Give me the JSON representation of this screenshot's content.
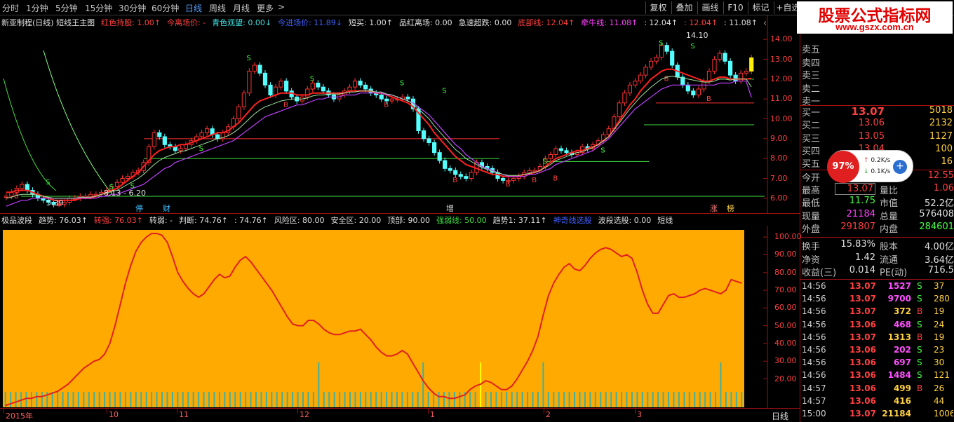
{
  "toolbar": {
    "periods": [
      "分时",
      "1分钟",
      "5分钟",
      "15分钟",
      "30分钟",
      "60分钟",
      "日线",
      "周线",
      "月线",
      "更多"
    ],
    "active_period": "日线",
    "more_arrow": ">",
    "buttons": [
      "复权",
      "叠加",
      "画线",
      "F10",
      "标记",
      "+自选"
    ]
  },
  "watermark": {
    "title": "股票公式指标网",
    "url": "www.gszx.com.cn"
  },
  "main_legend": {
    "items": [
      {
        "text": "新亚制程(日线) 短线王主图",
        "color": "#e0e0e0"
      },
      {
        "text": "红色持股: 1.00↑",
        "color": "#ff4040"
      },
      {
        "text": "今离场价: -",
        "color": "#ff4040"
      },
      {
        "text": "青色观望: 0.00↓",
        "color": "#40e0e0"
      },
      {
        "text": "今进场价: 11.89↓",
        "color": "#4060ff"
      },
      {
        "text": "短买: 1.00↑",
        "color": "#e0e0e0"
      },
      {
        "text": "品红离场: 0.00",
        "color": "#e0e0e0"
      },
      {
        "text": "急速超跌: 0.00",
        "color": "#e0e0e0"
      },
      {
        "text": "底部线: 12.04↑",
        "color": "#ff4040"
      },
      {
        "text": "牵牛线: 11.08↑",
        "color": "#ff40ff"
      },
      {
        "text": ": 12.04↑",
        "color": "#e0e0e0"
      },
      {
        "text": ": 12.04↑",
        "color": "#ff4040"
      },
      {
        "text": ": 11.08↑",
        "color": "#e0e0e0"
      },
      {
        "text": "◇ ☐",
        "color": "#e0e0e0"
      }
    ]
  },
  "price_axis": {
    "ticks": [
      "14.00",
      "13.00",
      "12.00",
      "11.00",
      "10.00",
      "9.00",
      "8.00",
      "7.00",
      "6.00"
    ],
    "min": 5.5,
    "max": 14.5
  },
  "price_annotations": {
    "high": "14.10",
    "low": "5.39",
    "range": "8.13 - 6.20"
  },
  "event_markers": [
    {
      "text": "停",
      "color": "#40c0ff"
    },
    {
      "text": "财",
      "color": "#40c0ff"
    },
    {
      "text": "增",
      "color": "#e0e0e0"
    },
    {
      "text": "涨",
      "color": "#ff8080"
    },
    {
      "text": "榜",
      "color": "#ffd040"
    }
  ],
  "sub_legend": {
    "items": [
      {
        "text": "极品波段",
        "color": "#e0e0e0"
      },
      {
        "text": "趋势: 76.03↑",
        "color": "#e0e0e0"
      },
      {
        "text": "转强: 76.03↑",
        "color": "#ff4040"
      },
      {
        "text": "转弱: -",
        "color": "#e0e0e0"
      },
      {
        "text": "判断: 74.76↑",
        "color": "#e0e0e0"
      },
      {
        "text": ": 74.76↑",
        "color": "#e0e0e0"
      },
      {
        "text": "风险区: 80.00",
        "color": "#e0e0e0"
      },
      {
        "text": "安全区: 20.00",
        "color": "#e0e0e0"
      },
      {
        "text": "顶部: 90.00",
        "color": "#e0e0e0"
      },
      {
        "text": "强弱线: 50.00",
        "color": "#40e040"
      },
      {
        "text": "趋势1: 37.11↑",
        "color": "#e0e0e0"
      },
      {
        "text": "神奇线选股",
        "color": "#4060ff"
      },
      {
        "text": "波段选股: 0.00",
        "color": "#e0e0e0"
      },
      {
        "text": "短线",
        "color": "#e0e0e0"
      }
    ]
  },
  "osc_axis": {
    "ticks": [
      "100.00",
      "90.00",
      "80.00",
      "70.00",
      "60.00",
      "50.00",
      "40.00",
      "30.00",
      "20.00"
    ],
    "min": 4,
    "max": 104
  },
  "date_axis": {
    "labels": [
      "2015年",
      "10",
      "11",
      "12",
      "1",
      "2",
      "3"
    ],
    "right_label": "日线"
  },
  "chart_data": [
    {
      "type": "candlestick",
      "title": "新亚制程(日线) 短线王主图",
      "xlabel": "",
      "ylabel": "",
      "ylim": [
        5.5,
        14.5
      ],
      "x_labels": [
        "2015年",
        "10",
        "11",
        "12",
        "1",
        "2",
        "3"
      ],
      "close": [
        6.1,
        6.3,
        6.5,
        6.7,
        6.4,
        6.2,
        6.0,
        5.9,
        5.8,
        5.7,
        5.7,
        5.8,
        6.0,
        6.0,
        6.1,
        6.1,
        6.2,
        6.2,
        6.3,
        6.4,
        6.6,
        6.8,
        7.0,
        7.1,
        7.3,
        7.4,
        7.8,
        8.6,
        9.3,
        9.1,
        8.7,
        8.6,
        8.4,
        8.5,
        8.7,
        8.9,
        9.1,
        9.3,
        9.5,
        9.2,
        9.0,
        9.3,
        9.6,
        10.0,
        10.6,
        11.3,
        12.4,
        12.7,
        12.3,
        11.7,
        11.2,
        11.6,
        11.9,
        11.4,
        11.1,
        10.9,
        11.1,
        11.5,
        11.8,
        11.6,
        11.4,
        11.2,
        11.0,
        11.2,
        11.4,
        11.6,
        11.9,
        11.7,
        11.5,
        11.3,
        11.2,
        11.0,
        10.9,
        11.0,
        11.0,
        11.1,
        11.0,
        10.5,
        9.4,
        9.0,
        8.8,
        8.3,
        7.9,
        7.5,
        7.4,
        7.2,
        7.1,
        7.0,
        7.3,
        7.8,
        7.6,
        7.5,
        7.3,
        7.0,
        6.9,
        6.9,
        7.0,
        7.1,
        7.3,
        7.4,
        7.4,
        7.6,
        8.0,
        8.2,
        8.5,
        8.4,
        8.3,
        8.2,
        8.3,
        8.6,
        8.5,
        8.7,
        8.9,
        9.2,
        9.5,
        10.1,
        10.8,
        11.3,
        11.7,
        11.9,
        12.2,
        12.6,
        12.9,
        13.1,
        13.7,
        13.4,
        12.7,
        12.1,
        11.7,
        11.4,
        11.2,
        11.5,
        11.9,
        12.4,
        13.0,
        13.3,
        12.9,
        12.2,
        11.9,
        12.3,
        12.4,
        13.07
      ],
      "ma_short": [
        6.3,
        6.3,
        6.4,
        6.4,
        6.4,
        6.3,
        6.2,
        6.1,
        6.0,
        5.9,
        5.9,
        5.9,
        5.9,
        5.9,
        6.0,
        6.0,
        6.0,
        6.1,
        6.2,
        6.3,
        6.4,
        6.5,
        6.7,
        6.9,
        7.1,
        7.3,
        7.6,
        7.9,
        8.2,
        8.4,
        8.5,
        8.6,
        8.6,
        8.7,
        8.7,
        8.8,
        8.9,
        9.0,
        9.1,
        9.2,
        9.3,
        9.3,
        9.4,
        9.6,
        9.8,
        10.1,
        10.4,
        10.7,
        10.9,
        11.0,
        11.1,
        11.2,
        11.3,
        11.3,
        11.3,
        11.2,
        11.2,
        11.2,
        11.3,
        11.3,
        11.3,
        11.3,
        11.3,
        11.3,
        11.3,
        11.4,
        11.4,
        11.4,
        11.4,
        11.4,
        11.3,
        11.3,
        11.2,
        11.1,
        11.0,
        10.9,
        10.8,
        10.6,
        10.3,
        10.0,
        9.7,
        9.3,
        9.0,
        8.7,
        8.4,
        8.1,
        7.9,
        7.7,
        7.6,
        7.5,
        7.4,
        7.3,
        7.2,
        7.2,
        7.1,
        7.1,
        7.1,
        7.1,
        7.2,
        7.2,
        7.3,
        7.4,
        7.6,
        7.8,
        8.0,
        8.1,
        8.2,
        8.3,
        8.4,
        8.4,
        8.5,
        8.6,
        8.7,
        8.9,
        9.1,
        9.5,
        9.9,
        10.3,
        10.7,
        11.0,
        11.4,
        11.7,
        12.0,
        12.2,
        12.4,
        12.5,
        12.5,
        12.4,
        12.3,
        12.2,
        12.1,
        12.0,
        11.9,
        11.9,
        12.0,
        12.1,
        12.1,
        12.0,
        12.0,
        12.0,
        12.0,
        12.04
      ],
      "ma_long": [
        5.6,
        5.7,
        5.8,
        5.9,
        5.9,
        6.0,
        6.0,
        6.0,
        6.0,
        6.0,
        6.0,
        6.0,
        6.0,
        6.0,
        6.0,
        6.0,
        6.0,
        6.0,
        6.1,
        6.1,
        6.2,
        6.2,
        6.3,
        6.4,
        6.5,
        6.6,
        6.7,
        6.9,
        7.1,
        7.3,
        7.5,
        7.6,
        7.8,
        7.9,
        8.0,
        8.1,
        8.2,
        8.3,
        8.4,
        8.5,
        8.6,
        8.7,
        8.8,
        8.9,
        9.1,
        9.3,
        9.5,
        9.7,
        9.9,
        10.1,
        10.2,
        10.3,
        10.4,
        10.5,
        10.6,
        10.7,
        10.7,
        10.8,
        10.9,
        11.0,
        11.0,
        11.1,
        11.1,
        11.1,
        11.2,
        11.2,
        11.2,
        11.3,
        11.3,
        11.3,
        11.3,
        11.3,
        11.2,
        11.2,
        11.1,
        11.0,
        10.9,
        10.8,
        10.6,
        10.4,
        10.2,
        9.9,
        9.6,
        9.3,
        9.0,
        8.7,
        8.5,
        8.2,
        8.0,
        7.8,
        7.6,
        7.5,
        7.4,
        7.3,
        7.2,
        7.1,
        7.1,
        7.1,
        7.1,
        7.2,
        7.2,
        7.3,
        7.4,
        7.5,
        7.7,
        7.8,
        7.9,
        8.0,
        8.1,
        8.2,
        8.3,
        8.4,
        8.6,
        8.8,
        9.0,
        9.3,
        9.6,
        9.9,
        10.2,
        10.5,
        10.7,
        10.9,
        11.1,
        11.3,
        11.5,
        11.6,
        11.7,
        11.7,
        11.7,
        11.7,
        11.7,
        11.7,
        11.7,
        11.7,
        11.7,
        11.8,
        11.8,
        11.8,
        11.9,
        11.9,
        11.9,
        11.08
      ]
    },
    {
      "type": "line",
      "title": "极品波段",
      "xlabel": "",
      "ylabel": "",
      "ylim": [
        4,
        104
      ],
      "series": [
        {
          "name": "趋势",
          "values": [
            5,
            6,
            7,
            8,
            9,
            9,
            10,
            10,
            11,
            12,
            13,
            15,
            17,
            20,
            23,
            26,
            28,
            30,
            31,
            34,
            40,
            50,
            62,
            74,
            84,
            92,
            97,
            100,
            102,
            102,
            101,
            97,
            89,
            80,
            75,
            71,
            68,
            66,
            68,
            72,
            76,
            79,
            77,
            78,
            83,
            87,
            89,
            86,
            82,
            78,
            74,
            70,
            65,
            60,
            55,
            51,
            50,
            50,
            53,
            53,
            51,
            48,
            46,
            45,
            45,
            46,
            47,
            47,
            48,
            45,
            42,
            38,
            35,
            33,
            33,
            34,
            36,
            34,
            29,
            24,
            19,
            15,
            12,
            10,
            10,
            9,
            9,
            10,
            11,
            14,
            16,
            17,
            19,
            18,
            16,
            14,
            14,
            16,
            20,
            25,
            30,
            36,
            44,
            56,
            67,
            74,
            79,
            83,
            85,
            82,
            81,
            84,
            88,
            91,
            93,
            94,
            93,
            91,
            89,
            90,
            88,
            80,
            70,
            62,
            57,
            57,
            62,
            67,
            68,
            66,
            66,
            67,
            68,
            70,
            71,
            70,
            69,
            68,
            70,
            76,
            75,
            74
          ]
        }
      ]
    }
  ],
  "order_book": {
    "asks": [
      {
        "label": "卖五",
        "price": "",
        "vol": ""
      },
      {
        "label": "卖四",
        "price": "",
        "vol": ""
      },
      {
        "label": "卖三",
        "price": "",
        "vol": ""
      },
      {
        "label": "卖二",
        "price": "",
        "vol": ""
      },
      {
        "label": "卖一",
        "price": "",
        "vol": ""
      }
    ],
    "bids": [
      {
        "label": "买一",
        "price": "13.07",
        "vol": "5018"
      },
      {
        "label": "买二",
        "price": "13.06",
        "vol": "2132"
      },
      {
        "label": "买三",
        "price": "13.05",
        "vol": "1127"
      },
      {
        "label": "买四",
        "price": "13.04",
        "vol": "100"
      },
      {
        "label": "买五",
        "price": "13.03",
        "vol": "16"
      }
    ]
  },
  "stats": {
    "rows": [
      {
        "l1": "今开",
        "v1": "",
        "l2": "昨收",
        "v2": "12.55"
      },
      {
        "l1": "最高",
        "v1": "13.07",
        "l2": "量比",
        "v2": "1.06"
      },
      {
        "l1": "最低",
        "v1": "11.75",
        "l2": "市值",
        "v2": "52.2亿"
      },
      {
        "l1": "现量",
        "v1": "21184",
        "l2": "总量",
        "v2": "576408"
      },
      {
        "l1": "外盘",
        "v1": "291807",
        "l2": "内盘",
        "v2": "284601"
      }
    ],
    "rows2": [
      {
        "l1": "换手",
        "v1": "15.83%",
        "l2": "股本",
        "v2": "4.00亿"
      },
      {
        "l1": "净资",
        "v1": "1.42",
        "l2": "流通",
        "v2": "3.64亿"
      },
      {
        "l1": "收益(三)",
        "v1": "0.014",
        "l2": "PE(动)",
        "v2": "716.5"
      }
    ]
  },
  "widget": {
    "percent": "97%",
    "up": "0.2K/s",
    "down": "0.1K/s"
  },
  "trades": [
    {
      "time": "14:56",
      "price": "13.07",
      "vol": "1527",
      "bs": "S",
      "n": "37"
    },
    {
      "time": "14:56",
      "price": "13.07",
      "vol": "9700",
      "bs": "S",
      "n": "280"
    },
    {
      "time": "14:56",
      "price": "13.07",
      "vol": "372",
      "bs": "B",
      "n": "19"
    },
    {
      "time": "14:56",
      "price": "13.06",
      "vol": "468",
      "bs": "S",
      "n": "24"
    },
    {
      "time": "14:56",
      "price": "13.07",
      "vol": "1313",
      "bs": "B",
      "n": "19"
    },
    {
      "time": "14:56",
      "price": "13.06",
      "vol": "202",
      "bs": "S",
      "n": "23"
    },
    {
      "time": "14:56",
      "price": "13.06",
      "vol": "697",
      "bs": "S",
      "n": "30"
    },
    {
      "time": "14:56",
      "price": "13.06",
      "vol": "1484",
      "bs": "S",
      "n": "121"
    },
    {
      "time": "14:57",
      "price": "13.06",
      "vol": "499",
      "bs": "B",
      "n": "26"
    },
    {
      "time": "14:57",
      "price": "13.06",
      "vol": "416",
      "bs": "",
      "n": "44"
    },
    {
      "time": "15:00",
      "price": "13.07",
      "vol": "21184",
      "bs": "",
      "n": "1006"
    }
  ],
  "colors": {
    "up": "#ff3232",
    "down": "#54ffff",
    "ma_short": "#ff2020",
    "ma_long": "#c040ff",
    "osc_bg": "#ffaa00",
    "osc_line": "#e02020"
  }
}
